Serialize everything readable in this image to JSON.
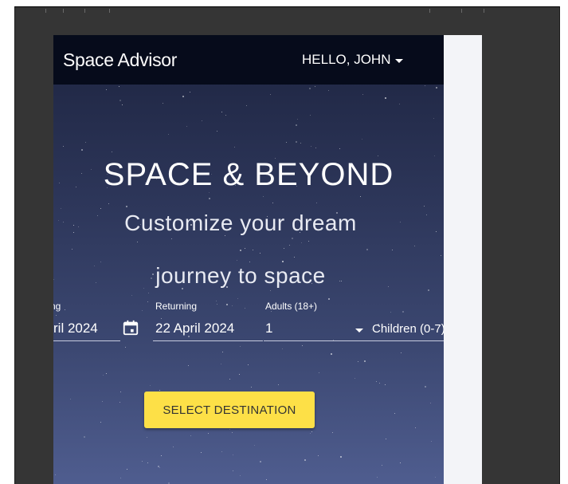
{
  "navbar": {
    "brand": "Space Advisor",
    "user_menu_label": "HELLO, JOHN"
  },
  "hero": {
    "title": "SPACE & BEYOND",
    "subtitle_line1": "Customize your dream",
    "subtitle_line2": "journey to space"
  },
  "search_form": {
    "departing": {
      "label_visible": "ng",
      "value_visible": "ril 2024"
    },
    "returning": {
      "label": "Returning",
      "value": "22 April 2024"
    },
    "adults": {
      "label": "Adults (18+)",
      "value": "1"
    },
    "children": {
      "label": "Children (0-7)"
    }
  },
  "cta": {
    "label": "SELECT DESTINATION"
  },
  "colors": {
    "navbar_bg": "#060b1b",
    "cta_bg": "#fde047",
    "outer_bg": "#353535"
  },
  "icons": [
    "calendar-icon",
    "chevron-down-icon"
  ]
}
